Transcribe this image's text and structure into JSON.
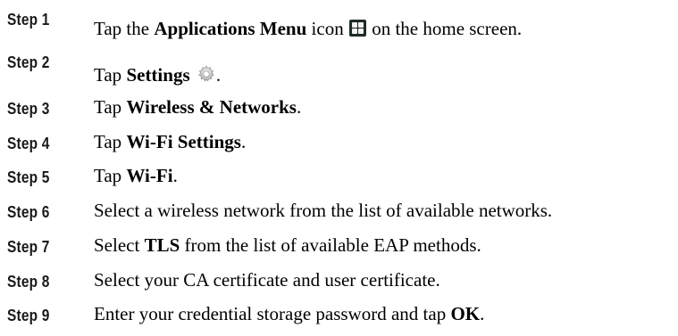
{
  "steps": [
    {
      "label": "Step 1",
      "parts": [
        "Tap the ",
        "Applications Menu",
        " icon ",
        " on the home screen."
      ],
      "icon": "applications-menu-icon"
    },
    {
      "label": "Step 2",
      "parts": [
        "Tap ",
        "Settings",
        " ",
        "."
      ],
      "icon": "settings-gear-icon"
    },
    {
      "label": "Step 3",
      "parts": [
        "Tap ",
        "Wireless & Networks",
        "."
      ]
    },
    {
      "label": "Step 4",
      "parts": [
        "Tap ",
        "Wi-Fi Settings",
        "."
      ]
    },
    {
      "label": "Step 5",
      "parts": [
        "Tap ",
        "Wi-Fi",
        "."
      ]
    },
    {
      "label": "Step 6",
      "parts": [
        "Select a wireless network from the list of available networks."
      ]
    },
    {
      "label": "Step 7",
      "parts": [
        "Select ",
        "TLS",
        " from the list of available EAP methods."
      ]
    },
    {
      "label": "Step 8",
      "parts": [
        "Select your CA certificate and user certificate."
      ]
    },
    {
      "label": "Step 9",
      "parts": [
        "Enter your credential storage password and tap ",
        "OK",
        "."
      ]
    }
  ]
}
